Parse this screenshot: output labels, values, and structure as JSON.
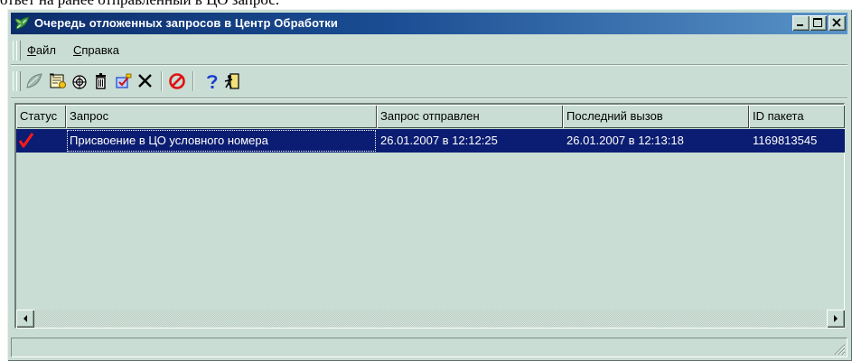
{
  "page": {
    "caption_fragment": "ответ на ранее отправленный в ЦО запрос."
  },
  "window": {
    "title": "Очередь отложенных запросов в Центр Обработки",
    "icon": "leaf-app-icon"
  },
  "title_buttons": {
    "minimize": "minimize-icon",
    "maximize": "maximize-icon",
    "close": "close-icon"
  },
  "menu": {
    "items": [
      {
        "label_first": "Ф",
        "label_rest": "айл"
      },
      {
        "label_first": "С",
        "label_rest": "правка"
      }
    ]
  },
  "toolbar": {
    "icons": [
      "send-request-icon",
      "certificate-icon",
      "lock-icon",
      "delete-icon",
      "edit-check-icon",
      "remove-x-icon",
      "cancel-icon",
      "help-icon",
      "exit-icon"
    ],
    "colors": {
      "cancel": "#e01010",
      "help": "#1a3fd1",
      "remove": "#000000"
    }
  },
  "table": {
    "columns": [
      "Статус",
      "Запрос",
      "Запрос отправлен",
      "Последний вызов",
      "ID пакета"
    ],
    "rows": [
      {
        "status_icon": "red-checkmark-icon",
        "request": "Присвоение в ЦО условного номера",
        "sent": "26.01.2007 в 12:12:25",
        "last_call": "26.01.2007 в 12:13:18",
        "packet_id": "1169813545"
      }
    ],
    "selected_row_color": "#0b1d72"
  },
  "scrollbar": {
    "left": "arrow-left-icon",
    "right": "arrow-right-icon"
  },
  "statusbar": {
    "grip": "size-grip-icon"
  }
}
